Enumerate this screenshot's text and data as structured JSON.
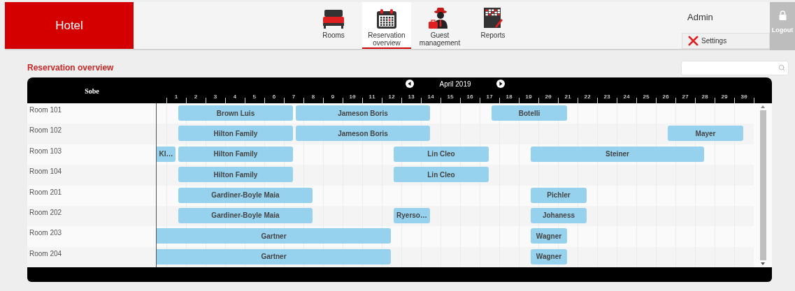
{
  "app": {
    "title": "Hotel"
  },
  "nav": [
    {
      "label": "Rooms",
      "kind": "bed",
      "selected": false
    },
    {
      "label": "Reservation overview",
      "kind": "calendar",
      "selected": true
    },
    {
      "label": "Guest management",
      "kind": "guest",
      "selected": false
    },
    {
      "label": "Reports",
      "kind": "report",
      "selected": false
    }
  ],
  "user": {
    "name": "Admin",
    "settings": "Settings",
    "logout": "Logout"
  },
  "page": {
    "title": "Reservation overview"
  },
  "calendar": {
    "room_header": "Sobe",
    "month": "April 2019",
    "days": [
      "1",
      "2",
      "3",
      "4",
      "5",
      "6",
      "7",
      "8",
      "9",
      "10",
      "11",
      "12",
      "13",
      "14",
      "15",
      "16",
      "17",
      "18",
      "19",
      "20",
      "21",
      "22",
      "23",
      "24",
      "25",
      "26",
      "27",
      "28",
      "29",
      "30"
    ],
    "rows": [
      {
        "room": "Room 101",
        "bookings": [
          {
            "guest": "Brown Luis",
            "starts_before": false
          },
          {
            "guest": "Jameson Boris",
            "starts_before": false
          },
          {
            "guest": "Botelli",
            "starts_before": false
          }
        ]
      },
      {
        "room": "Room 102",
        "bookings": [
          {
            "guest": "Hilton Family",
            "starts_before": false
          },
          {
            "guest": "Jameson Boris",
            "starts_before": false
          },
          {
            "guest": "Mayer",
            "starts_before": false
          }
        ]
      },
      {
        "room": "Room 103",
        "bookings": [
          {
            "guest": "Kl…",
            "starts_before": true
          },
          {
            "guest": "Hilton Family",
            "starts_before": false
          },
          {
            "guest": "Lin Cleo",
            "starts_before": false
          },
          {
            "guest": "Steiner",
            "starts_before": false
          }
        ]
      },
      {
        "room": "Room 104",
        "bookings": [
          {
            "guest": "Hilton Family",
            "starts_before": false
          },
          {
            "guest": "Lin Cleo",
            "starts_before": false
          }
        ]
      },
      {
        "room": "Room 201",
        "bookings": [
          {
            "guest": "Gardiner-Boyle Maia",
            "starts_before": false
          },
          {
            "guest": "Pichler",
            "starts_before": false
          }
        ]
      },
      {
        "room": "Room 202",
        "bookings": [
          {
            "guest": "Gardiner-Boyle Maia",
            "starts_before": false
          },
          {
            "guest": "Ryerso…",
            "starts_before": false
          },
          {
            "guest": "Johaness",
            "starts_before": false
          }
        ]
      },
      {
        "room": "Room 203",
        "bookings": [
          {
            "guest": "Gartner",
            "starts_before": true
          },
          {
            "guest": "Wagner",
            "starts_before": false
          }
        ]
      },
      {
        "room": "Room 204",
        "bookings": [
          {
            "guest": "Gartner",
            "starts_before": true
          },
          {
            "guest": "Wagner",
            "starts_before": false
          }
        ]
      }
    ]
  }
}
